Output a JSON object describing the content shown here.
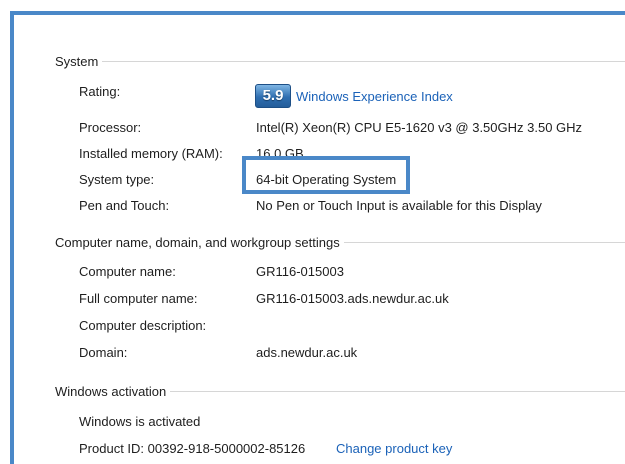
{
  "system": {
    "header": "System",
    "rating_label": "Rating:",
    "rating_score": "5.9",
    "rating_link": "Windows Experience Index",
    "processor_label": "Processor:",
    "processor_value": "Intel(R) Xeon(R) CPU E5-1620 v3 @ 3.50GHz   3.50 GHz",
    "memory_label": "Installed memory (RAM):",
    "memory_value": "16.0 GB",
    "system_type_label": "System type:",
    "system_type_value": "64-bit Operating System",
    "pen_label": "Pen and Touch:",
    "pen_value": "No Pen or Touch Input is available for this Display"
  },
  "computer": {
    "header": "Computer name, domain, and workgroup settings",
    "name_label": "Computer name:",
    "name_value": "GR116-015003",
    "full_name_label": "Full computer name:",
    "full_name_value": "GR116-015003.ads.newdur.ac.uk",
    "description_label": "Computer description:",
    "description_value": "",
    "domain_label": "Domain:",
    "domain_value": "ads.newdur.ac.uk"
  },
  "activation": {
    "header": "Windows activation",
    "status": "Windows is activated",
    "product_id": "Product ID:  00392-918-5000002-85126",
    "change_key_link": "Change product key"
  },
  "colors": {
    "frame_blue": "#4a88c8",
    "link_blue": "#1b62b8"
  }
}
